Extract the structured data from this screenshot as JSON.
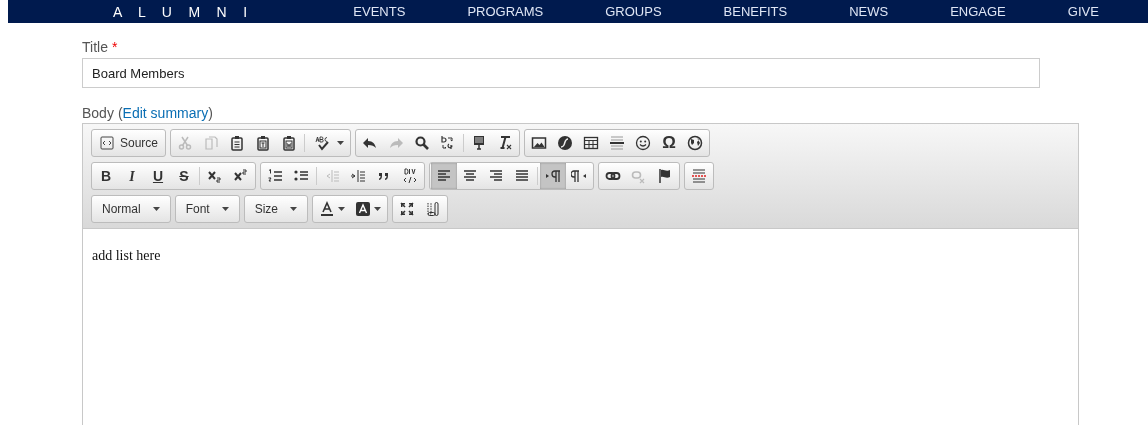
{
  "nav": {
    "logo": "A L U M N I",
    "items": [
      "EVENTS",
      "PROGRAMS",
      "GROUPS",
      "BENEFITS",
      "NEWS",
      "ENGAGE",
      "GIVE"
    ]
  },
  "title_field": {
    "label": "Title",
    "required_mark": "*",
    "value": "Board Members"
  },
  "body_field": {
    "label": "Body",
    "open": "(",
    "link": "Edit summary",
    "close": ")"
  },
  "toolbar": [
    [
      [
        {
          "kind": "source",
          "label": "Source"
        }
      ],
      [
        {
          "kind": "button",
          "disabled": true
        },
        {
          "kind": "button",
          "disabled": true
        },
        {
          "kind": "button",
          "disabled": false
        },
        {
          "kind": "button",
          "disabled": false
        },
        {
          "kind": "button",
          "disabled": false
        },
        {
          "kind": "separator"
        },
        {
          "kind": "menu",
          "disabled": false
        }
      ],
      [
        {
          "kind": "button",
          "disabled": false
        },
        {
          "kind": "button",
          "disabled": true
        },
        {
          "kind": "button",
          "disabled": false
        },
        {
          "kind": "button",
          "disabled": false
        },
        {
          "kind": "separator"
        },
        {
          "kind": "button",
          "disabled": false
        },
        {
          "kind": "button",
          "disabled": false
        }
      ],
      [
        {
          "kind": "button",
          "disabled": false
        },
        {
          "kind": "button",
          "disabled": false
        },
        {
          "kind": "button",
          "disabled": false
        },
        {
          "kind": "button",
          "disabled": false
        },
        {
          "kind": "button",
          "disabled": false
        },
        {
          "kind": "glyph",
          "label": "Ω",
          "disabled": false
        },
        {
          "kind": "button",
          "disabled": false
        }
      ]
    ],
    [
      [
        {
          "kind": "glyph",
          "label": "B",
          "disabled": false
        },
        {
          "kind": "glyph",
          "label": "I",
          "disabled": false
        },
        {
          "kind": "glyph",
          "label": "U",
          "disabled": false
        },
        {
          "kind": "glyph",
          "label": "S",
          "disabled": false
        },
        {
          "kind": "separator"
        },
        {
          "kind": "button",
          "disabled": false
        },
        {
          "kind": "button",
          "disabled": false
        }
      ],
      [
        {
          "kind": "button",
          "disabled": false
        },
        {
          "kind": "button",
          "disabled": false
        },
        {
          "kind": "separator"
        },
        {
          "kind": "button",
          "disabled": true
        },
        {
          "kind": "button",
          "disabled": false
        },
        {
          "kind": "button",
          "disabled": false
        },
        {
          "kind": "button",
          "disabled": false
        }
      ],
      [
        {
          "kind": "button",
          "disabled": false,
          "on": true
        },
        {
          "kind": "button",
          "disabled": false,
          "on": false
        },
        {
          "kind": "button",
          "disabled": false,
          "on": false
        },
        {
          "kind": "button",
          "disabled": false,
          "on": false
        },
        {
          "kind": "separator"
        },
        {
          "kind": "button",
          "disabled": false,
          "on": true
        },
        {
          "kind": "button",
          "disabled": false,
          "on": false
        }
      ],
      [
        {
          "kind": "button",
          "disabled": false
        },
        {
          "kind": "button",
          "disabled": true
        },
        {
          "kind": "button",
          "disabled": false
        }
      ],
      [
        {
          "kind": "button",
          "disabled": false
        }
      ]
    ],
    [
      [
        {
          "kind": "combo",
          "label": "Normal"
        }
      ],
      [
        {
          "kind": "combo",
          "label": "Font"
        }
      ],
      [
        {
          "kind": "combo",
          "label": "Size"
        }
      ],
      [
        {
          "kind": "menu",
          "disabled": false
        },
        {
          "kind": "menu",
          "disabled": false
        }
      ],
      [
        {
          "kind": "button",
          "disabled": false
        },
        {
          "kind": "button",
          "disabled": false
        }
      ]
    ]
  ],
  "content": "add list here"
}
